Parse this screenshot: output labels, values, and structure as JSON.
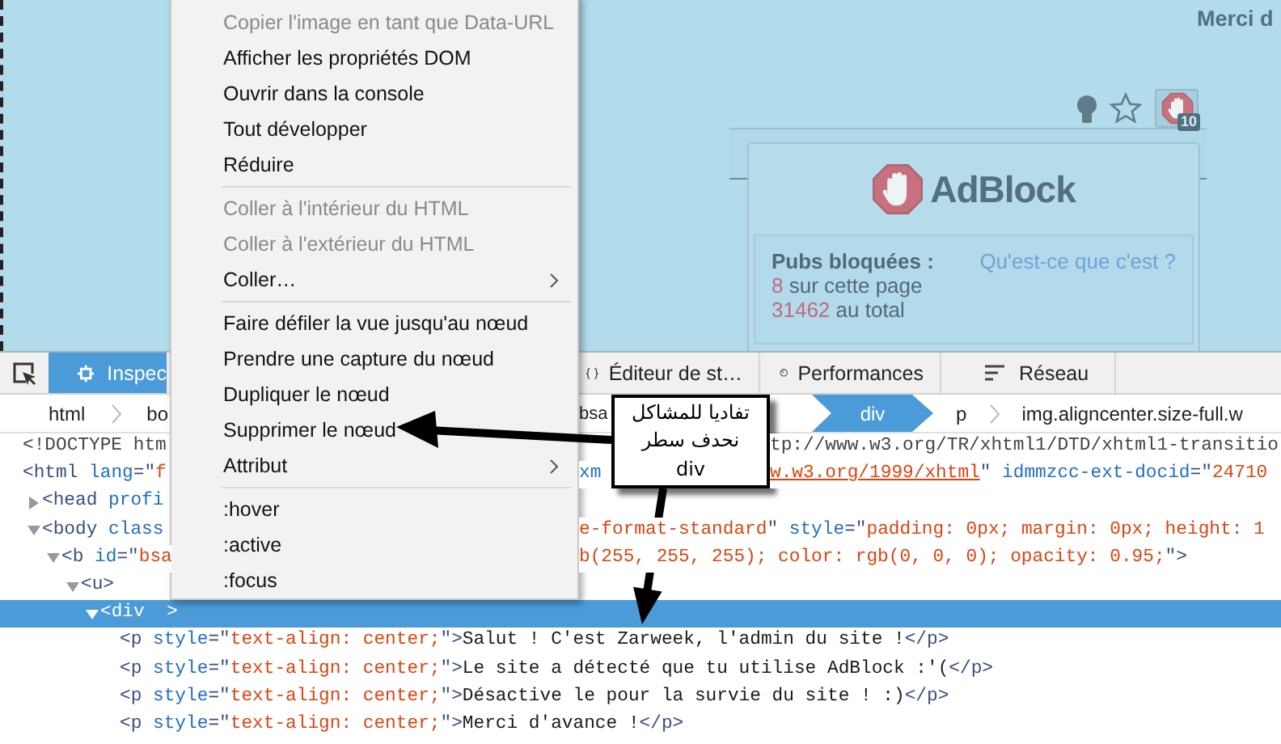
{
  "page": {
    "heading": "Merci d",
    "toolbar": {
      "badge": "10"
    },
    "adblock_popup": {
      "title": "AdBlock",
      "blocked_label": "Pubs bloquées :",
      "help_link": "Qu'est-ce que c'est ?",
      "stats": [
        {
          "count": "8",
          "label": "sur cette page"
        },
        {
          "count": "31462",
          "label": "au total"
        }
      ]
    }
  },
  "devtools": {
    "tabs": [
      {
        "kind": "inspector",
        "label": "Inspec",
        "selected": true
      },
      {
        "kind": "styleeditor",
        "label": "Éditeur de st…",
        "selected": false
      },
      {
        "kind": "performance",
        "label": "Performances",
        "selected": false
      },
      {
        "kind": "network",
        "label": "Réseau",
        "selected": false
      }
    ],
    "breadcrumbs": [
      {
        "label": "html",
        "selected": false
      },
      {
        "label": "bo",
        "selected": false
      },
      {
        "label": "bsa",
        "selected": false
      },
      {
        "label": "div",
        "selected": true
      },
      {
        "label": "p",
        "selected": false
      },
      {
        "label": "img.aligncenter.size-full.w",
        "selected": false
      }
    ],
    "markup": [
      {
        "selected": false,
        "segments": [
          [
            {
              "kind": "doctype",
              "text": "<!DOCTYPE htm"
            }
          ],
          [
            {
              "kind": "doctype",
              "text": "tp://www.w3.org/TR/xhtml1/DTD/xhtml1-transitio"
            }
          ]
        ]
      },
      {
        "selected": false,
        "segments": [
          [
            {
              "kind": "tag",
              "text": "<html"
            },
            {
              "kind": "attr",
              "text": " lang"
            },
            {
              "kind": "tag",
              "text": "=\""
            },
            {
              "kind": "value",
              "text": "f"
            }
          ],
          [
            {
              "kind": "attr",
              "text": "xm"
            }
          ],
          [
            {
              "kind": "link",
              "text": "w.w3.org/1999/xhtml"
            },
            {
              "kind": "tag",
              "text": "\" "
            },
            {
              "kind": "attr",
              "text": "idmmzcc-ext-docid"
            },
            {
              "kind": "tag",
              "text": "=\""
            },
            {
              "kind": "value",
              "text": "24710"
            }
          ]
        ],
        "children": [
          {
            "expanded": false,
            "selected": false,
            "segments": [
              [
                {
                  "kind": "tag",
                  "text": "<head"
                },
                {
                  "kind": "attr",
                  "text": " profi"
                }
              ]
            ]
          },
          {
            "expanded": true,
            "selected": false,
            "segments": [
              [
                {
                  "kind": "tag",
                  "text": "<body"
                },
                {
                  "kind": "attr",
                  "text": " class"
                }
              ],
              [
                {
                  "kind": "value",
                  "text": "e-format-standard"
                },
                {
                  "kind": "tag",
                  "text": "\" "
                },
                {
                  "kind": "attr",
                  "text": "style"
                },
                {
                  "kind": "tag",
                  "text": "=\""
                },
                {
                  "kind": "value",
                  "text": "padding: 0px; margin: 0px; height: 1"
                }
              ]
            ],
            "children": [
              {
                "expanded": true,
                "selected": false,
                "segments": [
                  [
                    {
                      "kind": "tag",
                      "text": "<b"
                    },
                    {
                      "kind": "attr",
                      "text": " id"
                    },
                    {
                      "kind": "tag",
                      "text": "=\""
                    },
                    {
                      "kind": "value",
                      "text": "bsa"
                    }
                  ],
                  [
                    {
                      "kind": "value",
                      "text": "b(255, 255, 255); color: rgb(0, 0, 0); opacity: 0.95;"
                    },
                    {
                      "kind": "tag",
                      "text": "\">"
                    }
                  ]
                ],
                "children": [
                  {
                    "expanded": true,
                    "selected": false,
                    "segments": [
                      [
                        {
                          "kind": "tag",
                          "text": "<u>"
                        }
                      ]
                    ],
                    "children": [
                      {
                        "expanded": true,
                        "selected": true,
                        "segments": [
                          [
                            {
                              "text": "<div  >"
                            }
                          ]
                        ],
                        "children": [
                          {
                            "selected": false,
                            "segments": [
                              [
                                {
                                  "kind": "tag",
                                  "text": "<p"
                                },
                                {
                                  "kind": "attr",
                                  "text": " style"
                                },
                                {
                                  "kind": "tag",
                                  "text": "=\""
                                },
                                {
                                  "kind": "value",
                                  "text": "text-align: center;"
                                },
                                {
                                  "kind": "tag",
                                  "text": "\">"
                                },
                                {
                                  "kind": "text",
                                  "text": "Salut ! C'est Zarweek, l'admin du site !"
                                },
                                {
                                  "kind": "tag",
                                  "text": "</p>"
                                }
                              ]
                            ]
                          },
                          {
                            "selected": false,
                            "segments": [
                              [
                                {
                                  "kind": "tag",
                                  "text": "<p"
                                },
                                {
                                  "kind": "attr",
                                  "text": " style"
                                },
                                {
                                  "kind": "tag",
                                  "text": "=\""
                                },
                                {
                                  "kind": "value",
                                  "text": "text-align: center;"
                                },
                                {
                                  "kind": "tag",
                                  "text": "\">"
                                },
                                {
                                  "kind": "text",
                                  "text": "Le site a détecté que tu utilise AdBlock :'("
                                },
                                {
                                  "kind": "tag",
                                  "text": "</p>"
                                }
                              ]
                            ]
                          },
                          {
                            "selected": false,
                            "segments": [
                              [
                                {
                                  "kind": "tag",
                                  "text": "<p"
                                },
                                {
                                  "kind": "attr",
                                  "text": " style"
                                },
                                {
                                  "kind": "tag",
                                  "text": "=\""
                                },
                                {
                                  "kind": "value",
                                  "text": "text-align: center;"
                                },
                                {
                                  "kind": "tag",
                                  "text": "\">"
                                },
                                {
                                  "kind": "text",
                                  "text": "Désactive le pour la survie du site ! :)"
                                },
                                {
                                  "kind": "tag",
                                  "text": "</p>"
                                }
                              ]
                            ]
                          },
                          {
                            "selected": false,
                            "segments": [
                              [
                                {
                                  "kind": "tag",
                                  "text": "<p"
                                },
                                {
                                  "kind": "attr",
                                  "text": " style"
                                },
                                {
                                  "kind": "tag",
                                  "text": "=\""
                                },
                                {
                                  "kind": "value",
                                  "text": "text-align: center;"
                                },
                                {
                                  "kind": "tag",
                                  "text": "\">"
                                },
                                {
                                  "kind": "text",
                                  "text": "Merci d'avance !"
                                },
                                {
                                  "kind": "tag",
                                  "text": "</p>"
                                }
                              ]
                            ]
                          }
                        ]
                      }
                    ]
                  }
                ]
              }
            ]
          }
        ]
      }
    ]
  },
  "context_menu": {
    "items": [
      {
        "kind": "item",
        "label": "Copier l'image en tant que Data-URL",
        "disabled": true,
        "submenu": false
      },
      {
        "kind": "item",
        "label": "Afficher les propriétés DOM",
        "disabled": false,
        "submenu": false
      },
      {
        "kind": "item",
        "label": "Ouvrir dans la console",
        "disabled": false,
        "submenu": false
      },
      {
        "kind": "item",
        "label": "Tout développer",
        "disabled": false,
        "submenu": false
      },
      {
        "kind": "item",
        "label": "Réduire",
        "disabled": false,
        "submenu": false
      },
      {
        "kind": "separator"
      },
      {
        "kind": "item",
        "label": "Coller à l'intérieur du HTML",
        "disabled": true,
        "submenu": false
      },
      {
        "kind": "item",
        "label": "Coller à l'extérieur du HTML",
        "disabled": true,
        "submenu": false
      },
      {
        "kind": "item",
        "label": "Coller…",
        "disabled": false,
        "submenu": true
      },
      {
        "kind": "separator"
      },
      {
        "kind": "item",
        "label": "Faire défiler la vue jusqu'au nœud",
        "disabled": false,
        "submenu": false
      },
      {
        "kind": "item",
        "label": "Prendre une capture du nœud",
        "disabled": false,
        "submenu": false
      },
      {
        "kind": "item",
        "label": "Dupliquer le nœud",
        "disabled": false,
        "submenu": false
      },
      {
        "kind": "item",
        "label": "Supprimer le nœud",
        "disabled": false,
        "submenu": false
      },
      {
        "kind": "item",
        "label": "Attribut",
        "disabled": false,
        "submenu": true
      },
      {
        "kind": "separator"
      },
      {
        "kind": "item",
        "label": ":hover",
        "disabled": false,
        "submenu": false
      },
      {
        "kind": "item",
        "label": ":active",
        "disabled": false,
        "submenu": false
      },
      {
        "kind": "item",
        "label": ":focus",
        "disabled": false,
        "submenu": false
      }
    ]
  },
  "annotation": {
    "lines": [
      "تفاديا للمشاكل",
      "نحدف سطر",
      "div"
    ]
  }
}
